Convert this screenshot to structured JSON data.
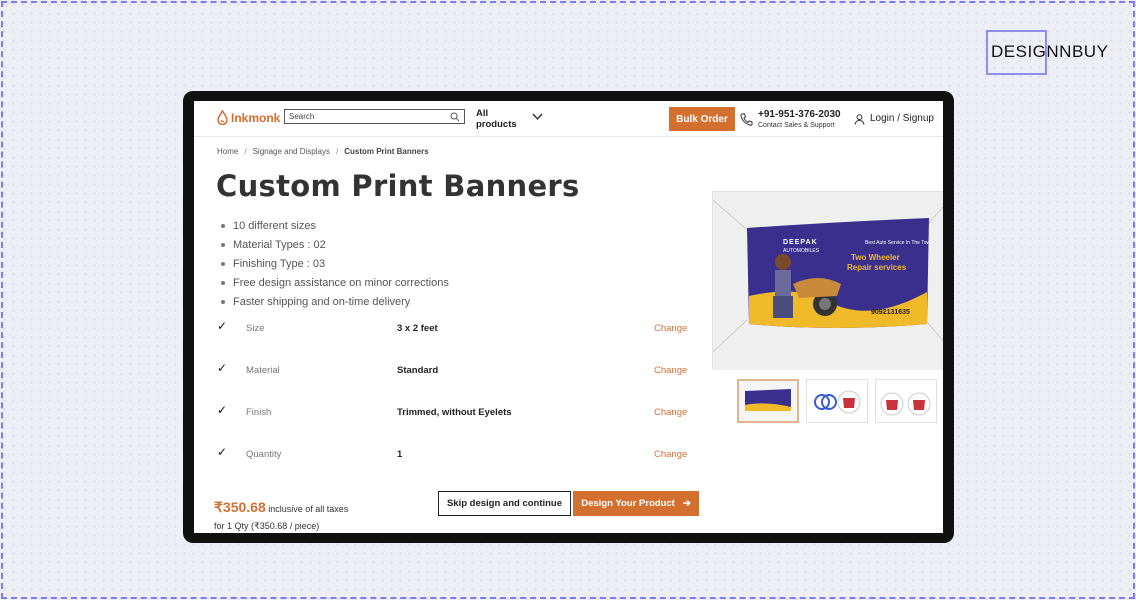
{
  "brand": {
    "name": "DESIGNNBUY"
  },
  "site": {
    "logo_text": "Inkmonk",
    "search_placeholder": "Search",
    "all_products": "All products",
    "bulk_order": "Bulk Order",
    "phone": "+91-951-376-2030",
    "phone_sub": "Contact Sales & Support",
    "login": "Login / Signup"
  },
  "breadcrumb": [
    {
      "label": "Home"
    },
    {
      "label": "Signage and Displays"
    },
    {
      "label": "Custom Print Banners"
    }
  ],
  "product": {
    "title": "Custom Print Banners",
    "features": [
      "10 different sizes",
      "Material Types : 02",
      "Finishing Type : 03",
      "Free design assistance on minor corrections",
      "Faster shipping and on-time delivery"
    ],
    "options": [
      {
        "label": "Size",
        "value": "3 x 2 feet",
        "action": "Change"
      },
      {
        "label": "Material",
        "value": "Standard",
        "action": "Change"
      },
      {
        "label": "Finish",
        "value": "Trimmed, without Eyelets",
        "action": "Change"
      },
      {
        "label": "Quantity",
        "value": "1",
        "action": "Change"
      }
    ],
    "price": "₹350.68",
    "price_note": "inclusive of all taxes",
    "per_piece": "for 1 Qty (₹350.68 / piece)",
    "skip_button": "Skip design and continue",
    "design_button": "Design Your Product"
  },
  "banner_art": {
    "company": "DEEPAK",
    "company_sub": "AUTOMOBILES",
    "tagline": "Best Auto Service In The Town",
    "headline_1": "Two Wheeler",
    "headline_2": "Repair services",
    "phone": "9092131635"
  },
  "colors": {
    "accent": "#d4702f",
    "banner_purple": "#3a2f8c",
    "banner_yellow": "#f0b92a"
  }
}
